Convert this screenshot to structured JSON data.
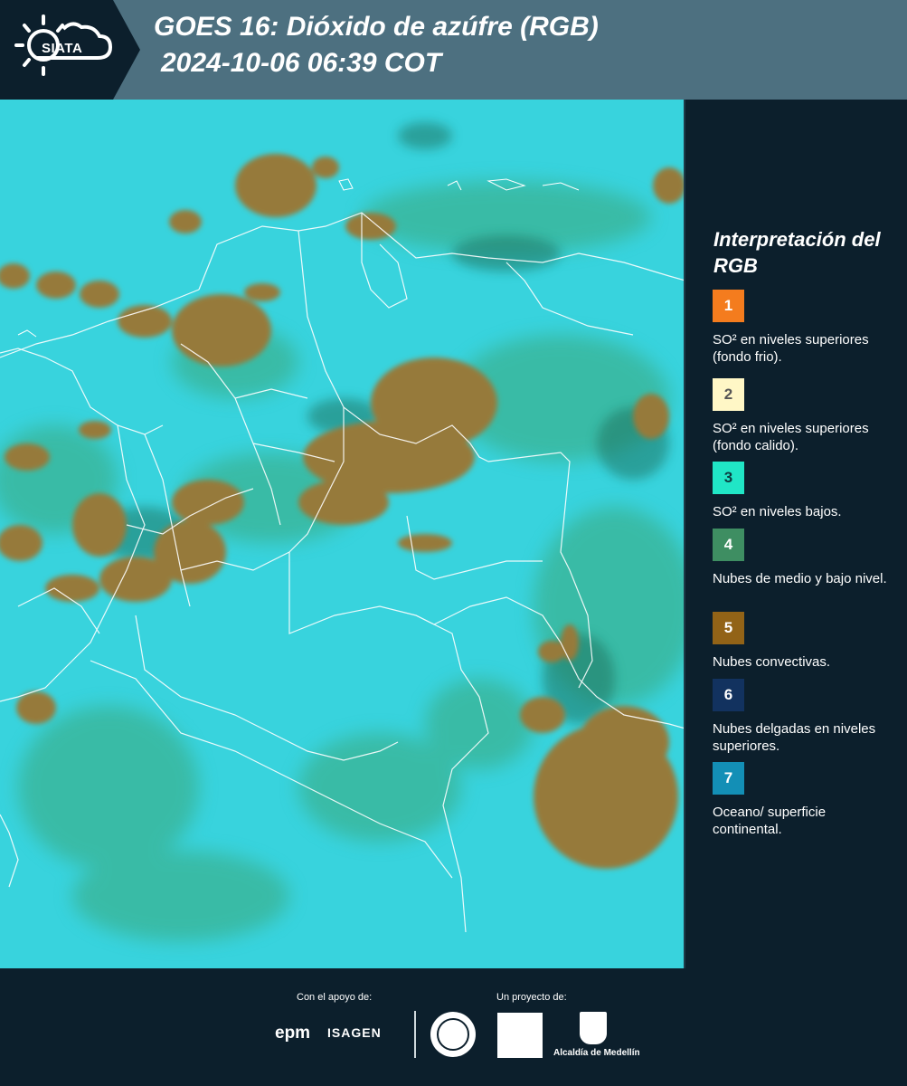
{
  "header": {
    "logo_text": "SIATA",
    "title": "GOES 16: Dióxido de azúfre (RGB)",
    "subtitle": "2024-10-06 06:39 COT"
  },
  "legend": {
    "title": "Interpretación del RGB",
    "items": [
      {
        "num": "1",
        "label": "SO² en niveles superiores (fondo frio).",
        "color": "#f47c1e",
        "num_color": "#ffffff"
      },
      {
        "num": "2",
        "label": "SO² en niveles superiores (fondo calido).",
        "color": "#fff7c6",
        "num_color": "#555555"
      },
      {
        "num": "3",
        "label": "SO² en niveles bajos.",
        "color": "#20e6c6",
        "num_color": "#0c3b3f"
      },
      {
        "num": "4",
        "label": "Nubes de medio y bajo nivel.",
        "color": "#3e8e62",
        "num_color": "#ffffff"
      },
      {
        "num": "5",
        "label": "Nubes convectivas.",
        "color": "#926317",
        "num_color": "#ffffff"
      },
      {
        "num": "6",
        "label": "Nubes delgadas en niveles superiores.",
        "color": "#12325f",
        "num_color": "#ffffff"
      },
      {
        "num": "7",
        "label": "Oceano/ superficie continental.",
        "color": "#138fb6",
        "num_color": "#ffffff"
      }
    ]
  },
  "footer": {
    "support_label": "Con el apoyo de:",
    "project_label": "Un proyecto de:",
    "sponsors": [
      "epm",
      "ISAGEN"
    ],
    "alcaldia": "Alcaldía de Medellín"
  }
}
